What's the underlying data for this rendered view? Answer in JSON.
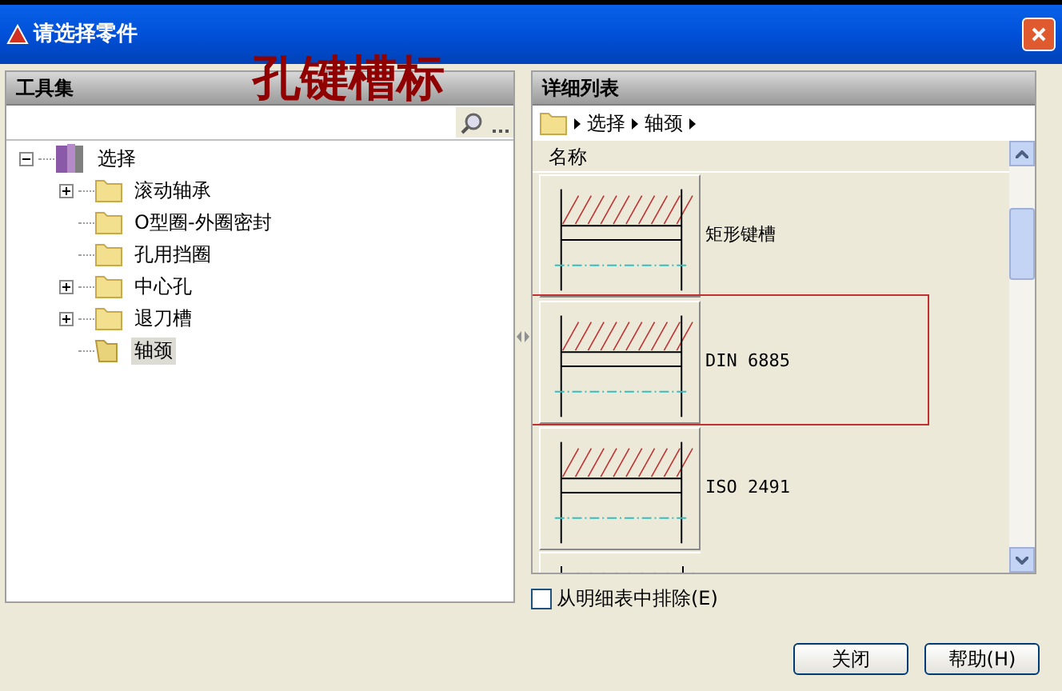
{
  "window": {
    "title": "请选择零件"
  },
  "annotation": {
    "text": "孔键槽标"
  },
  "toolset": {
    "title": "工具集",
    "tree": [
      {
        "label": "选择",
        "kind": "library",
        "expanded": true,
        "selected": false,
        "children": [
          {
            "label": "滚动轴承",
            "expanded": false,
            "selected": false
          },
          {
            "label": "O型圈-外圈密封",
            "selected": false
          },
          {
            "label": "孔用挡圈",
            "selected": false
          },
          {
            "label": "中心孔",
            "expanded": false,
            "selected": false
          },
          {
            "label": "退刀槽",
            "expanded": false,
            "selected": false
          },
          {
            "label": "轴颈",
            "selected": true
          }
        ]
      }
    ]
  },
  "details": {
    "title": "详细列表",
    "breadcrumb": [
      "选择",
      "轴颈"
    ],
    "column": "名称",
    "items": [
      {
        "name": "矩形键槽",
        "highlighted": false
      },
      {
        "name": "DIN 6885",
        "highlighted": true
      },
      {
        "name": "ISO 2491",
        "highlighted": false
      }
    ]
  },
  "exclude": {
    "label": "从明细表中排除(E)",
    "checked": false
  },
  "buttons": [
    "关闭",
    "帮助(H)"
  ]
}
